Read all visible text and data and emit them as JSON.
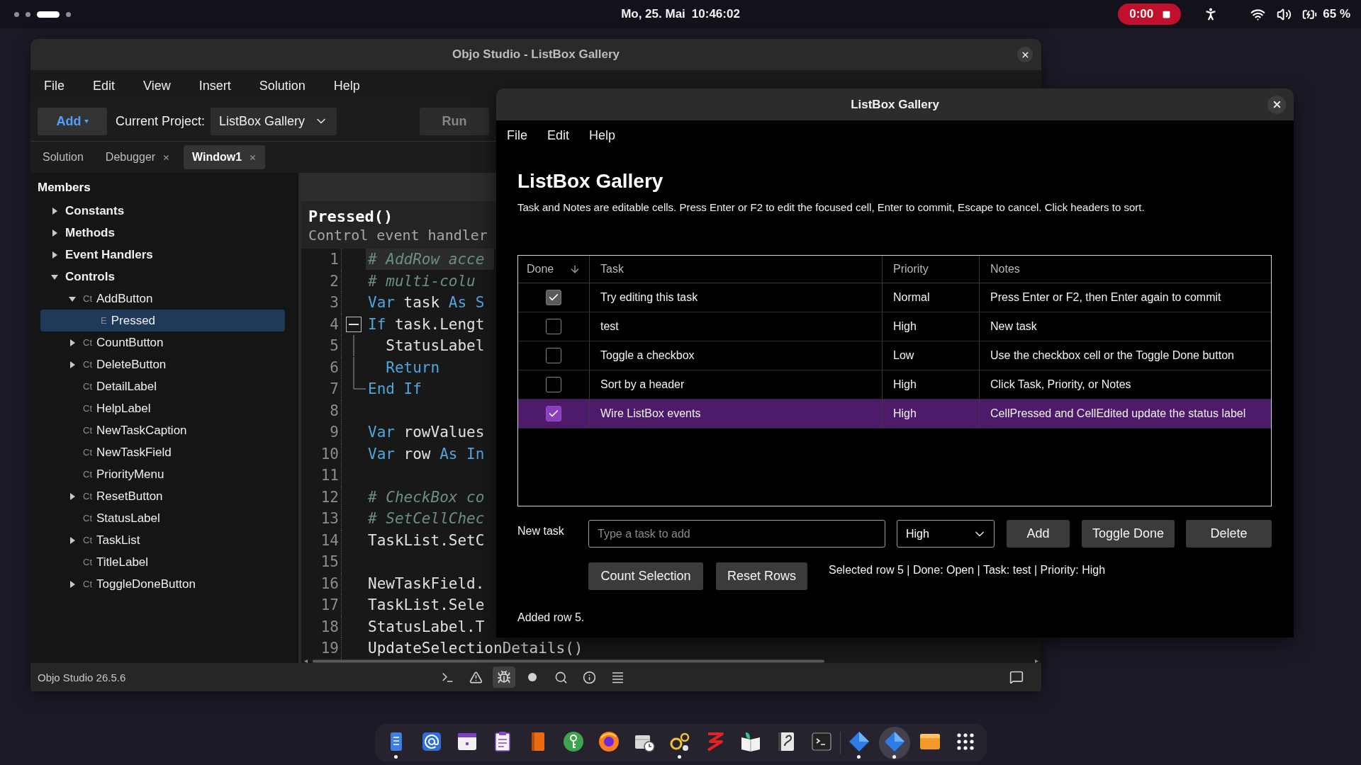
{
  "top_bar": {
    "workspaces": [
      {
        "selected": false
      },
      {
        "selected": false
      },
      {
        "selected": true
      },
      {
        "selected": false
      }
    ],
    "date": "Mo, 25. Mai",
    "time": "10:46:02",
    "recording": "0:00",
    "battery": "65 %"
  },
  "ide": {
    "title": "Objo Studio - ListBox Gallery",
    "menu": [
      "File",
      "Edit",
      "View",
      "Insert",
      "Solution",
      "Help"
    ],
    "toolbar": {
      "add": "Add",
      "project_label": "Current Project:",
      "project": "ListBox Gallery",
      "run": {
        "label": "Run",
        "disabled": true
      }
    },
    "tabs": [
      {
        "label": "Solution",
        "selected": false,
        "closable": false
      },
      {
        "label": "Debugger",
        "selected": false,
        "closable": true
      },
      {
        "label": "Window1",
        "selected": true,
        "closable": true
      }
    ],
    "members": {
      "title": "Members",
      "items": [
        {
          "kind": "category",
          "label": "Constants",
          "expanded": false,
          "selected": false
        },
        {
          "kind": "category",
          "label": "Methods",
          "expanded": false,
          "selected": false
        },
        {
          "kind": "category",
          "label": "Event Handlers",
          "expanded": false,
          "selected": false
        },
        {
          "kind": "category",
          "label": "Controls",
          "expanded": true,
          "selected": false,
          "children": [
            {
              "kind": "member",
              "badge": "Ct",
              "label": "AddButton",
              "expanded": true,
              "selected": false,
              "children": [
                {
                  "kind": "member",
                  "badge": "E",
                  "label": "Pressed",
                  "selected": true
                }
              ]
            },
            {
              "kind": "member",
              "badge": "Ct",
              "label": "CountButton",
              "expanded": false,
              "selected": false
            },
            {
              "kind": "member",
              "badge": "Ct",
              "label": "DeleteButton",
              "expanded": false,
              "selected": false
            },
            {
              "kind": "member",
              "badge": "Ct",
              "label": "DetailLabel",
              "selected": false
            },
            {
              "kind": "member",
              "badge": "Ct",
              "label": "HelpLabel",
              "selected": false
            },
            {
              "kind": "member",
              "badge": "Ct",
              "label": "NewTaskCaption",
              "selected": false
            },
            {
              "kind": "member",
              "badge": "Ct",
              "label": "NewTaskField",
              "selected": false
            },
            {
              "kind": "member",
              "badge": "Ct",
              "label": "PriorityMenu",
              "selected": false
            },
            {
              "kind": "member",
              "badge": "Ct",
              "label": "ResetButton",
              "expanded": false,
              "selected": false
            },
            {
              "kind": "member",
              "badge": "Ct",
              "label": "StatusLabel",
              "selected": false
            },
            {
              "kind": "member",
              "badge": "Ct",
              "label": "TaskList",
              "expanded": false,
              "selected": false
            },
            {
              "kind": "member",
              "badge": "Ct",
              "label": "TitleLabel",
              "selected": false
            },
            {
              "kind": "member",
              "badge": "Ct",
              "label": "ToggleDoneButton",
              "expanded": false,
              "selected": false
            }
          ]
        }
      ]
    },
    "editor": {
      "method": "Pressed()",
      "description": "Control event handler",
      "lines": [
        {
          "number": "1",
          "current": true,
          "tokens": [
            {
              "kind": "comment",
              "text": "# AddRow acce"
            }
          ]
        },
        {
          "number": "2",
          "current": false,
          "tokens": [
            {
              "kind": "comment",
              "text": "# multi-colu"
            }
          ]
        },
        {
          "number": "3",
          "current": false,
          "tokens": [
            {
              "kind": "keyword",
              "text": "Var"
            },
            {
              "kind": "plain",
              "text": " task "
            },
            {
              "kind": "keyword",
              "text": "As S"
            }
          ]
        },
        {
          "number": "4",
          "current": false,
          "expanded": true,
          "tokens": [
            {
              "kind": "keyword",
              "text": "If"
            },
            {
              "kind": "plain",
              "text": " task.Lengt"
            }
          ],
          "children": [
            {
              "number": "5",
              "current": false,
              "tokens": [
                {
                  "kind": "plain",
                  "text": "  StatusLabel"
                }
              ]
            },
            {
              "number": "6",
              "current": false,
              "tokens": [
                {
                  "kind": "keyword",
                  "text": "  Return"
                }
              ]
            },
            {
              "number": "7",
              "current": false,
              "tokens": [
                {
                  "kind": "keyword",
                  "text": "End If"
                }
              ]
            }
          ]
        },
        {
          "number": "8",
          "current": false
        },
        {
          "number": "9",
          "current": false,
          "tokens": [
            {
              "kind": "keyword",
              "text": "Var"
            },
            {
              "kind": "plain",
              "text": " rowValues"
            }
          ]
        },
        {
          "number": "10",
          "current": false,
          "tokens": [
            {
              "kind": "keyword",
              "text": "Var"
            },
            {
              "kind": "plain",
              "text": " row "
            },
            {
              "kind": "keyword",
              "text": "As In"
            }
          ]
        },
        {
          "number": "11",
          "current": false
        },
        {
          "number": "12",
          "current": false,
          "tokens": [
            {
              "kind": "comment",
              "text": "# CheckBox co"
            }
          ]
        },
        {
          "number": "13",
          "current": false,
          "tokens": [
            {
              "kind": "comment",
              "text": "# SetCellChec"
            }
          ]
        },
        {
          "number": "14",
          "current": false,
          "tokens": [
            {
              "kind": "plain",
              "text": "TaskList.SetC"
            }
          ]
        },
        {
          "number": "15",
          "current": false
        },
        {
          "number": "16",
          "current": false,
          "tokens": [
            {
              "kind": "plain",
              "text": "NewTaskField."
            }
          ]
        },
        {
          "number": "17",
          "current": false,
          "tokens": [
            {
              "kind": "plain",
              "text": "TaskList.Sele"
            }
          ]
        },
        {
          "number": "18",
          "current": false,
          "tokens": [
            {
              "kind": "plain",
              "text": "StatusLabel.T"
            }
          ]
        },
        {
          "number": "19",
          "current": false,
          "tokens": [
            {
              "kind": "plain",
              "text": "UpdateSelectionDetails()"
            }
          ]
        }
      ]
    },
    "status_bar": {
      "version": "Objo Studio 26.5.6",
      "tools": [
        {
          "kind": "console",
          "selected": false
        },
        {
          "kind": "warnings",
          "selected": false
        },
        {
          "kind": "debugger",
          "selected": true
        },
        {
          "kind": "breakpoint",
          "selected": false
        },
        {
          "kind": "search",
          "selected": false
        },
        {
          "kind": "info",
          "selected": false
        },
        {
          "kind": "outline",
          "selected": false
        }
      ]
    }
  },
  "dialog": {
    "title": "ListBox Gallery",
    "menu": [
      "File",
      "Edit",
      "Help"
    ],
    "heading": "ListBox Gallery",
    "help": "Task and Notes are editable cells. Press Enter or F2 to edit the focused cell, Enter to commit, Escape to cancel. Click headers to sort.",
    "table": {
      "columns": [
        {
          "label": "Done",
          "sorted": true,
          "descending": true
        },
        {
          "label": "Task",
          "sorted": false
        },
        {
          "label": "Priority",
          "sorted": false
        },
        {
          "label": "Notes",
          "sorted": false
        }
      ],
      "rows": [
        {
          "done": true,
          "task": "Try editing this task",
          "priority": "Normal",
          "notes": "Press Enter or F2, then Enter again to commit",
          "selected": false
        },
        {
          "done": false,
          "task": "test",
          "priority": "High",
          "notes": "New task",
          "selected": false
        },
        {
          "done": false,
          "task": "Toggle a checkbox",
          "priority": "Low",
          "notes": "Use the checkbox cell or the Toggle Done button",
          "selected": false
        },
        {
          "done": false,
          "task": "Sort by a header",
          "priority": "High",
          "notes": "Click Task, Priority, or Notes",
          "selected": false
        },
        {
          "done": true,
          "task": "Wire ListBox events",
          "priority": "High",
          "notes": "CellPressed and CellEdited update the status label",
          "selected": true
        }
      ]
    },
    "new_task": {
      "label": "New task",
      "placeholder": "Type a task to add",
      "priority": "High"
    },
    "buttons": [
      "Add",
      "Toggle Done",
      "Delete"
    ],
    "actions": [
      "Count Selection",
      "Reset Rows"
    ],
    "details": "Selected row 5 | Done: Open | Task: test | Priority: High",
    "status": "Added row 5."
  },
  "dock": {
    "pinned": [
      {
        "kind": "notebook",
        "running": true,
        "focused": false
      },
      {
        "kind": "mail",
        "running": false,
        "focused": false
      },
      {
        "kind": "calendar",
        "running": false,
        "focused": false
      },
      {
        "kind": "clipboard",
        "running": false,
        "focused": false
      },
      {
        "kind": "book",
        "running": false,
        "focused": false
      },
      {
        "kind": "key",
        "running": false,
        "focused": false
      },
      {
        "kind": "browser",
        "running": false,
        "focused": false
      },
      {
        "kind": "package",
        "running": false,
        "focused": false
      },
      {
        "kind": "gears",
        "running": true,
        "focused": false
      },
      {
        "kind": "zigzag",
        "running": false,
        "focused": false
      },
      {
        "kind": "reader",
        "running": false,
        "focused": false
      },
      {
        "kind": "journal",
        "running": false,
        "focused": false
      },
      {
        "kind": "terminal",
        "running": false,
        "focused": false
      }
    ],
    "open": [
      {
        "kind": "diamond",
        "running": true,
        "focused": false
      },
      {
        "kind": "diamond",
        "running": true,
        "focused": true
      },
      {
        "kind": "panel",
        "running": false,
        "focused": false
      }
    ]
  }
}
